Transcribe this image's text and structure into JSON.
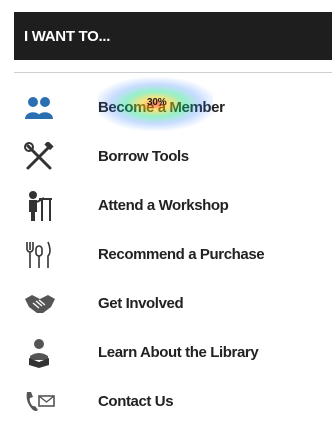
{
  "header": {
    "title": "I WANT TO..."
  },
  "overlay": {
    "heat_label": "30%"
  },
  "menu": {
    "items": [
      {
        "label": "Become a Member",
        "icon": "members-icon"
      },
      {
        "label": "Borrow Tools",
        "icon": "tools-icon"
      },
      {
        "label": "Attend a Workshop",
        "icon": "workshop-icon"
      },
      {
        "label": "Recommend a Purchase",
        "icon": "utensils-icon"
      },
      {
        "label": "Get Involved",
        "icon": "handshake-icon"
      },
      {
        "label": "Learn About the Library",
        "icon": "reader-icon"
      },
      {
        "label": "Contact Us",
        "icon": "phone-mail-icon"
      }
    ]
  },
  "colors": {
    "header_bg": "#1e1e1e",
    "header_text": "#ffffff",
    "item_text": "#222222"
  }
}
